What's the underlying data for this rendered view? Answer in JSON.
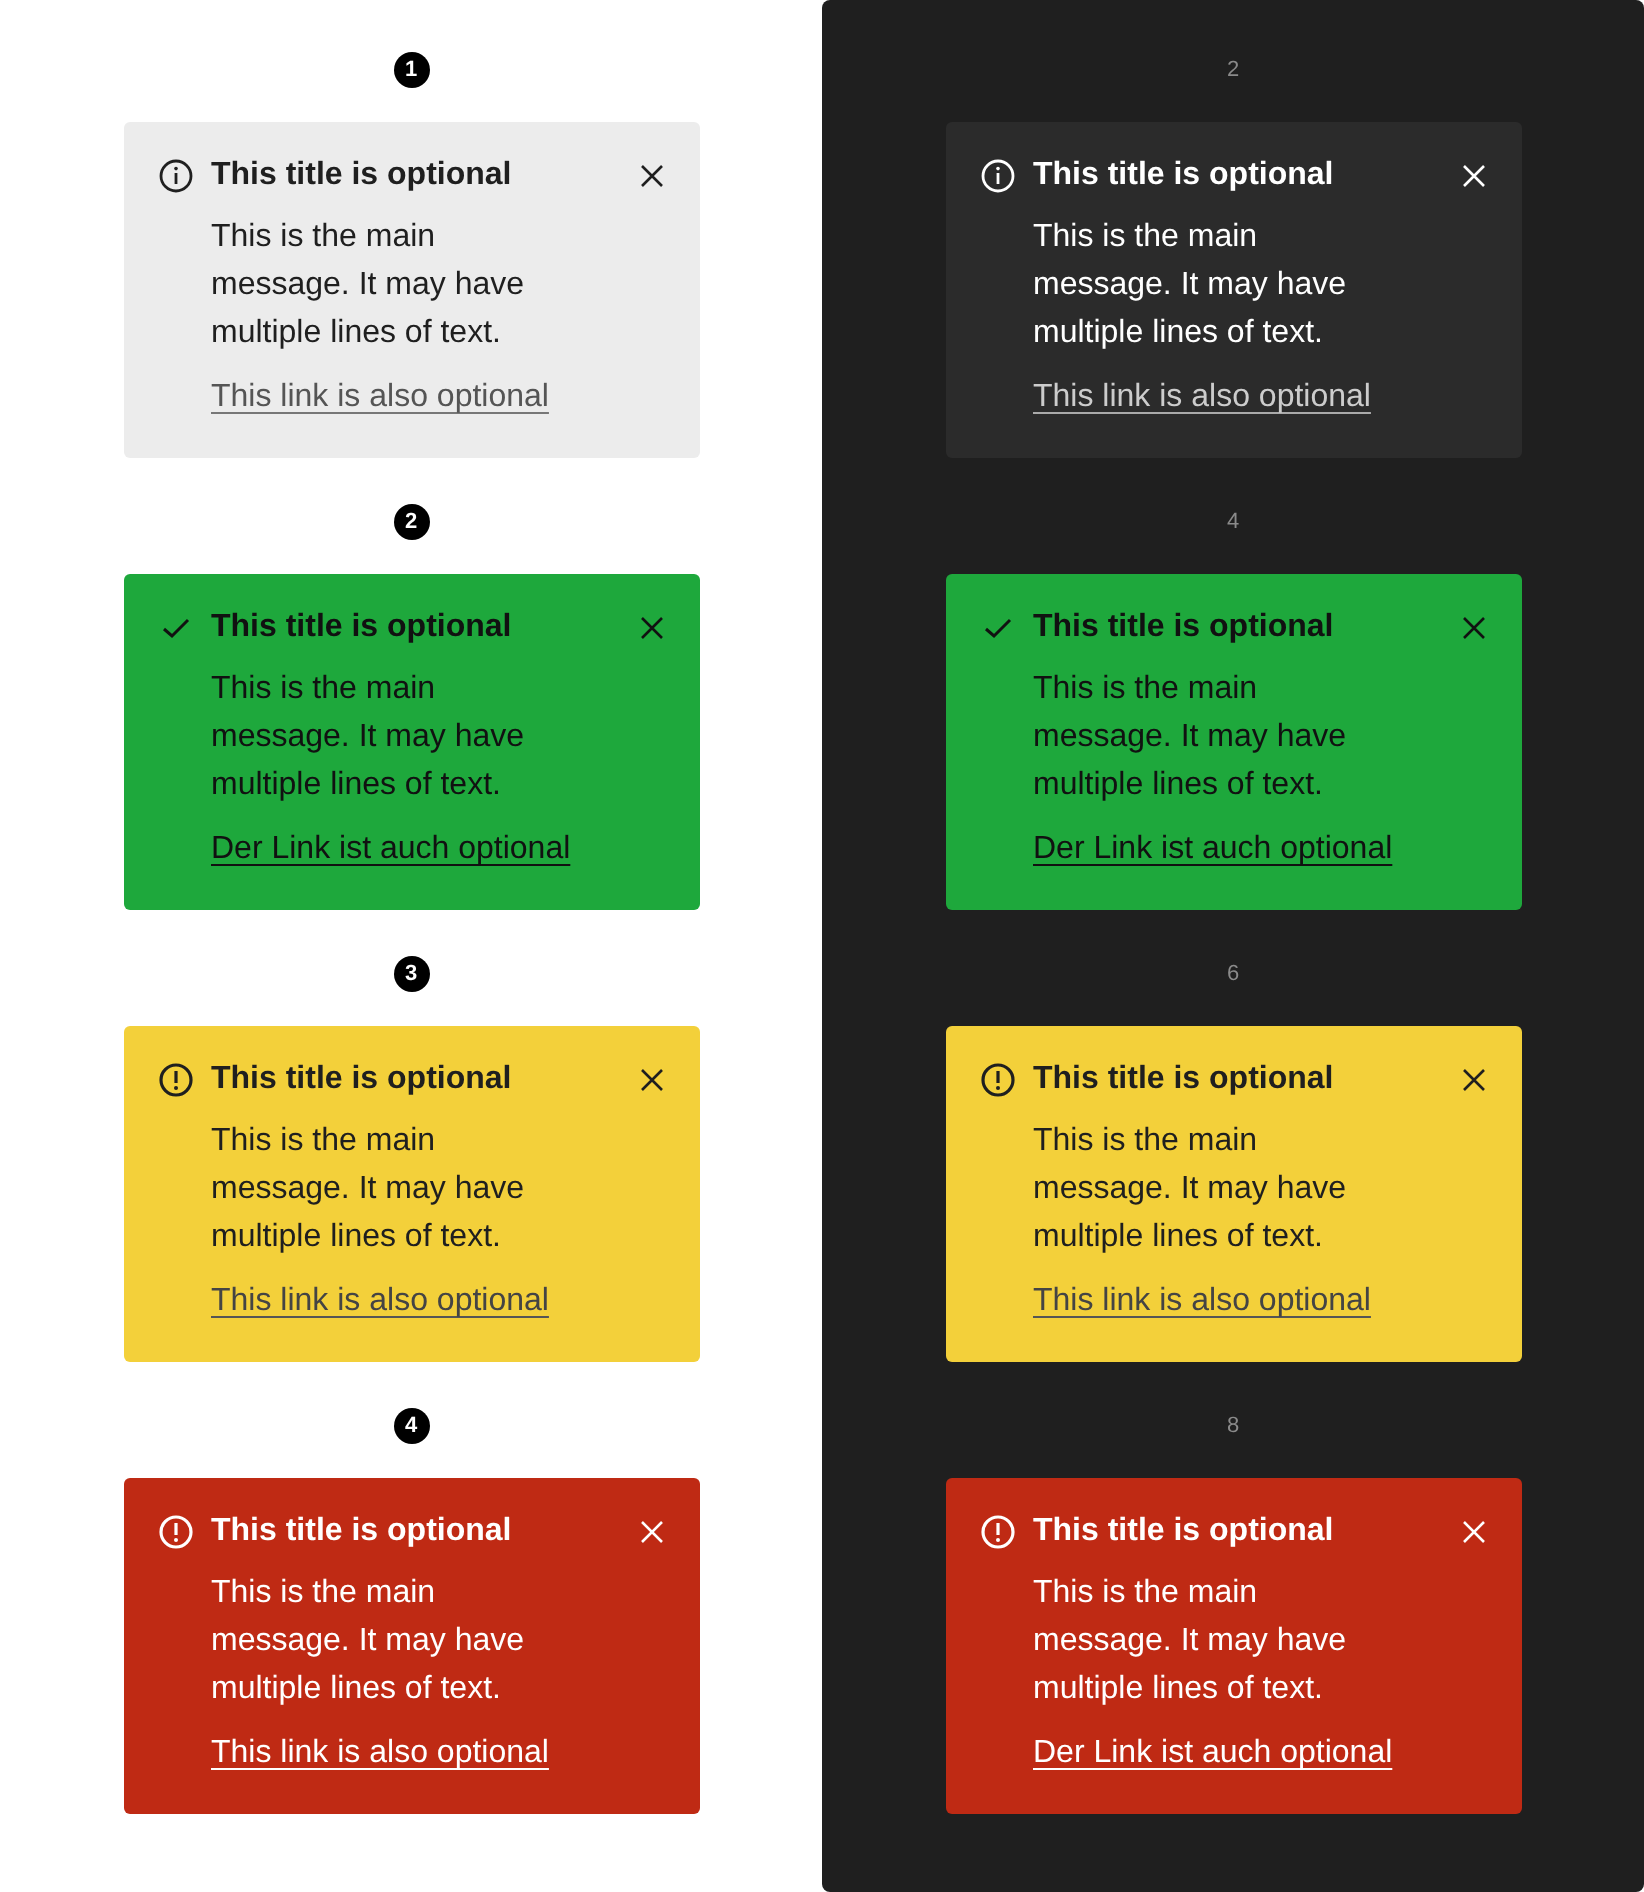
{
  "panels": [
    {
      "kind": "light",
      "rows": [
        {
          "marker": "1",
          "kind": "info",
          "title": "This title is optional",
          "message": "This is the main message. It may have multiple lines of text.",
          "link": "This link is also optional"
        },
        {
          "marker": "2",
          "kind": "success",
          "title": "This title is optional",
          "message": "This is the main message. It may have multiple lines of text.",
          "link": "Der Link ist auch optional"
        },
        {
          "marker": "3",
          "kind": "warning",
          "title": "This title is optional",
          "message": "This is the main message. It may have multiple lines of text.",
          "link": "This link is also optional"
        },
        {
          "marker": "4",
          "kind": "error",
          "title": "This title is optional",
          "message": "This is the main message. It may have multiple lines of text.",
          "link": "This link is also optional"
        }
      ]
    },
    {
      "kind": "dark",
      "rows": [
        {
          "marker": "2",
          "kind": "info",
          "title": "This title is optional",
          "message": "This is the main message. It may have multiple lines of text.",
          "link": "This link is also optional"
        },
        {
          "marker": "4",
          "kind": "success",
          "title": "This title is optional",
          "message": "This is the main message. It may have multiple lines of text.",
          "link": "Der Link ist auch optional"
        },
        {
          "marker": "6",
          "kind": "warning",
          "title": "This title is optional",
          "message": "This is the main message. It may have multiple lines of text.",
          "link": "This link is also optional"
        },
        {
          "marker": "8",
          "kind": "error",
          "title": "This title is optional",
          "message": "This is the main message. It may have multiple lines of text.",
          "link": "Der Link ist auch optional"
        }
      ]
    }
  ]
}
